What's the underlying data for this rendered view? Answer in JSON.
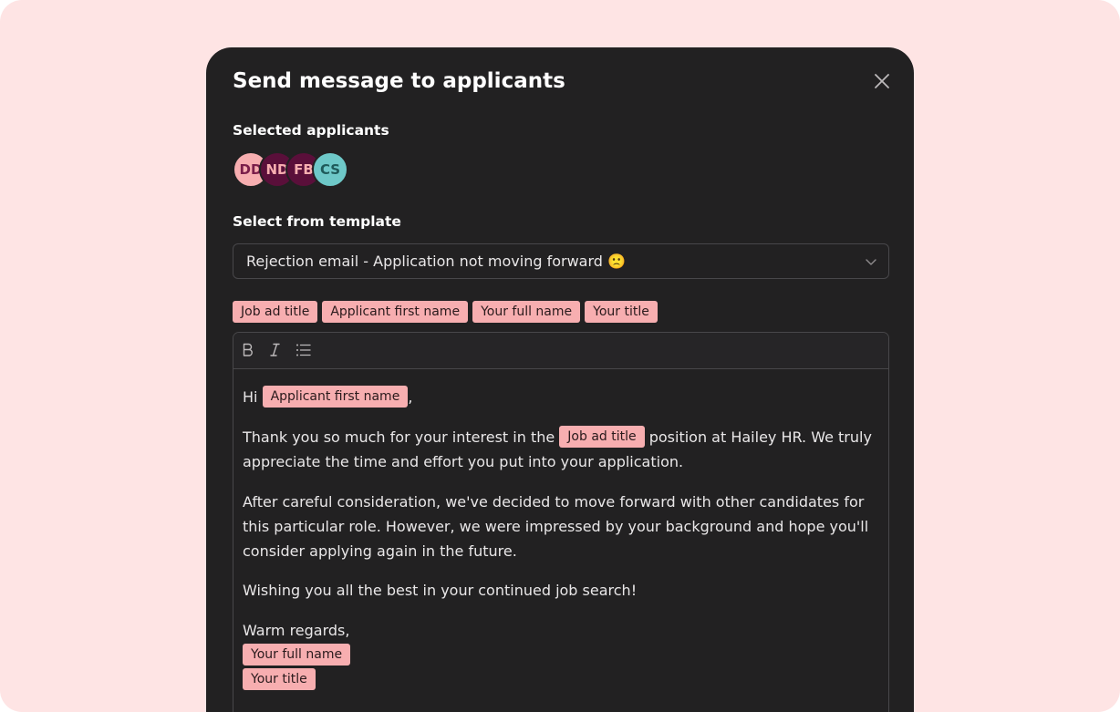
{
  "modal": {
    "title": "Send message to applicants",
    "close_icon": "close-icon"
  },
  "applicants": {
    "label": "Selected applicants",
    "avatars": [
      {
        "initials": "DD",
        "bg": "#f7aeb0",
        "fg": "#7a1e4a"
      },
      {
        "initials": "ND",
        "bg": "#5a0f3a",
        "fg": "#f7aeb0"
      },
      {
        "initials": "FB",
        "bg": "#5a0f3a",
        "fg": "#f7aeb0"
      },
      {
        "initials": "CS",
        "bg": "#6ec8c8",
        "fg": "#1f5a5a"
      }
    ]
  },
  "template": {
    "label": "Select from template",
    "selected": "Rejection email - Application not moving forward 🙁",
    "chevron_icon": "chevron-down-icon"
  },
  "variables": {
    "chips": [
      "Job ad title",
      "Applicant first name",
      "Your full name",
      "Your title"
    ]
  },
  "toolbar": {
    "bold_icon": "bold-icon",
    "italic_icon": "italic-icon",
    "list_icon": "bulleted-list-icon"
  },
  "message": {
    "greeting_prefix": "Hi",
    "greeting_chip": "Applicant first name",
    "greeting_suffix": ",",
    "p1_before": "Thank you so much for your interest in the",
    "p1_chip": "Job ad title",
    "p1_after": "position at Hailey HR. We truly appreciate the time and effort you put into your application.",
    "p2": "After careful consideration, we've decided to move forward with other candidates for this particular role. However, we were impressed by your background and hope you'll consider applying again in the future.",
    "p3": "Wishing you all the best in your continued job search!",
    "signoff": "Warm regards,",
    "sig_chip_1": "Your full name",
    "sig_chip_2": "Your title"
  },
  "colors": {
    "backdrop": "#fee4e4",
    "modal_bg": "#222122",
    "chip_bg": "#f7aeb0"
  }
}
